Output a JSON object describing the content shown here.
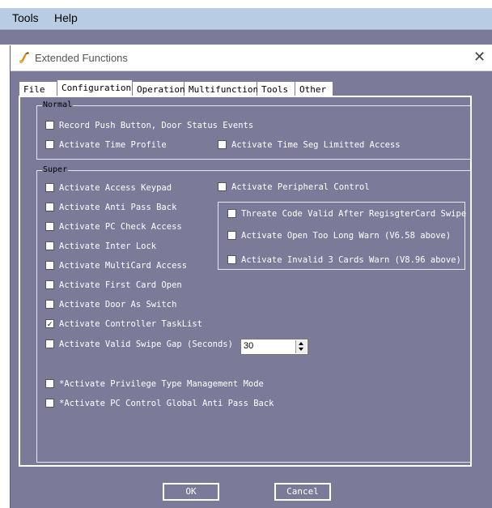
{
  "menubar": {
    "items": [
      "Tools",
      "Help"
    ]
  },
  "window": {
    "title": "Extended Functions"
  },
  "tabs": [
    "File",
    "Configuration",
    "Operation",
    "Multifunction",
    "Tools",
    "Other"
  ],
  "normal": {
    "label": "Normal",
    "items": [
      {
        "label": "Record Push Button, Door Status Events",
        "checked": false
      },
      {
        "label": "Activate Time Profile",
        "checked": false
      },
      {
        "label": "Activate Time Seg Limitted Access",
        "checked": false
      }
    ]
  },
  "super": {
    "label": "Super",
    "left": [
      {
        "label": "Activate Access Keypad",
        "checked": false
      },
      {
        "label": "Activate Anti Pass Back",
        "checked": false
      },
      {
        "label": "Activate PC Check Access",
        "checked": false
      },
      {
        "label": "Activate Inter Lock",
        "checked": false
      },
      {
        "label": "Activate MultiCard Access",
        "checked": false
      },
      {
        "label": "Activate First Card Open",
        "checked": false
      },
      {
        "label": "Activate Door As Switch",
        "checked": false
      },
      {
        "label": "Activate Controller TaskList",
        "checked": true
      },
      {
        "label": "Activate Valid Swipe Gap (Seconds)",
        "checked": false
      }
    ],
    "peripheral": {
      "label": "Activate Peripheral Control",
      "checked": false
    },
    "sub": [
      {
        "label": "Threate Code Valid After RegisgterCard Swipe",
        "checked": false
      },
      {
        "label": "Activate Open Too Long Warn (V6.58 above)",
        "checked": false
      },
      {
        "label": "Activate Invalid 3 Cards  Warn (V8.96 above)",
        "checked": false
      }
    ],
    "swipe_gap_value": "30",
    "extra": [
      {
        "label": "*Activate Privilege Type Management Mode",
        "checked": false
      },
      {
        "label": "*Activate PC Control Global Anti Pass Back",
        "checked": false
      }
    ]
  },
  "buttons": {
    "ok": "OK",
    "cancel": "Cancel"
  },
  "check_glyph": "✓"
}
